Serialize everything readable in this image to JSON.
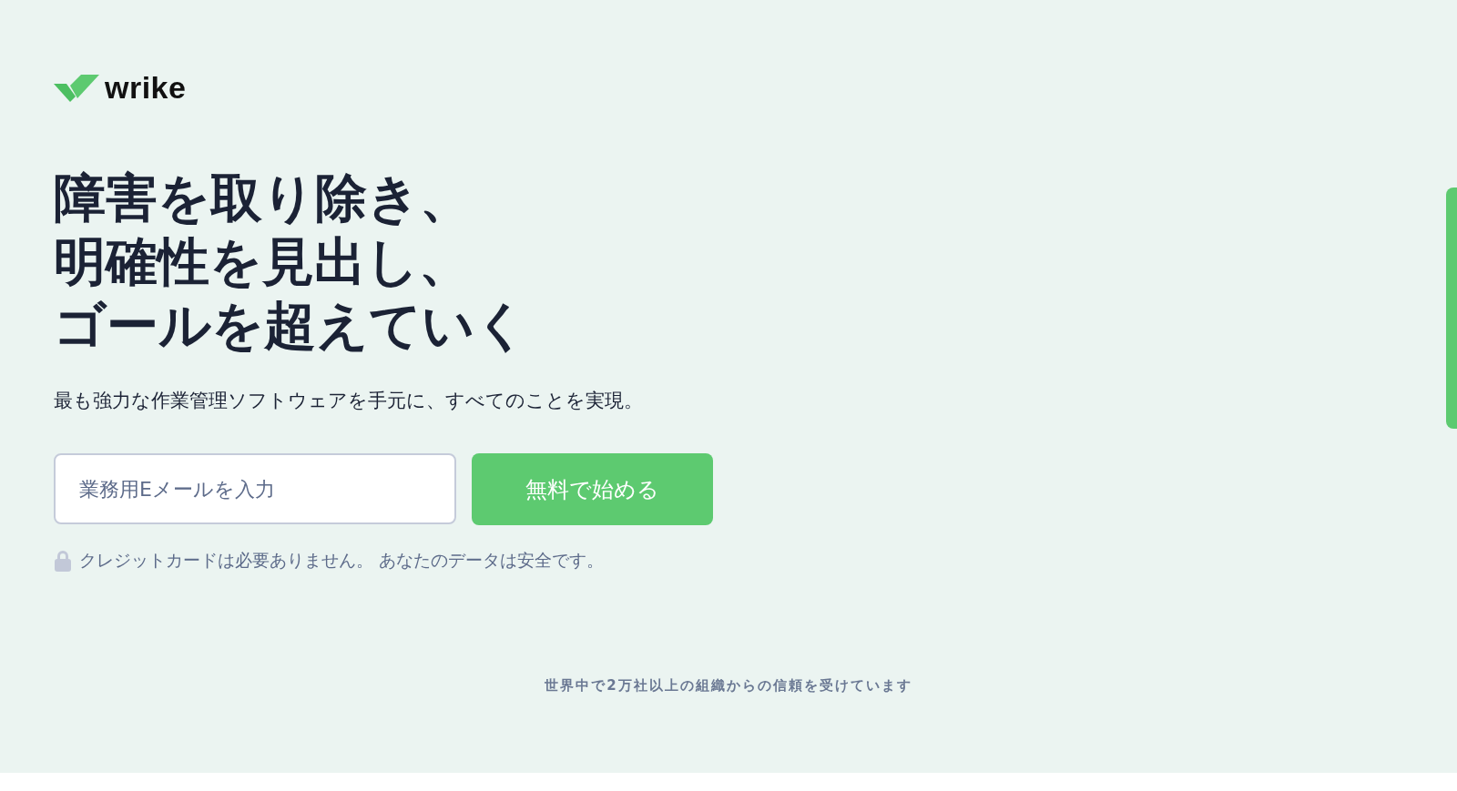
{
  "logo": {
    "text": "wrike"
  },
  "headline_lines": [
    "障害を取り除き、",
    "明確性を見出し、",
    "ゴールを超えていく"
  ],
  "subtitle": "最も強力な作業管理ソフトウェアを手元に、すべてのことを実現。",
  "signup": {
    "email_field": {
      "placeholder": "業務用Eメールを入力"
    },
    "button": "無料で始める"
  },
  "note": "クレジットカードは必要ありません。 あなたのデータは安全です。",
  "trust_line": "世界中で2万社以上の組織からの信頼を受けています"
}
